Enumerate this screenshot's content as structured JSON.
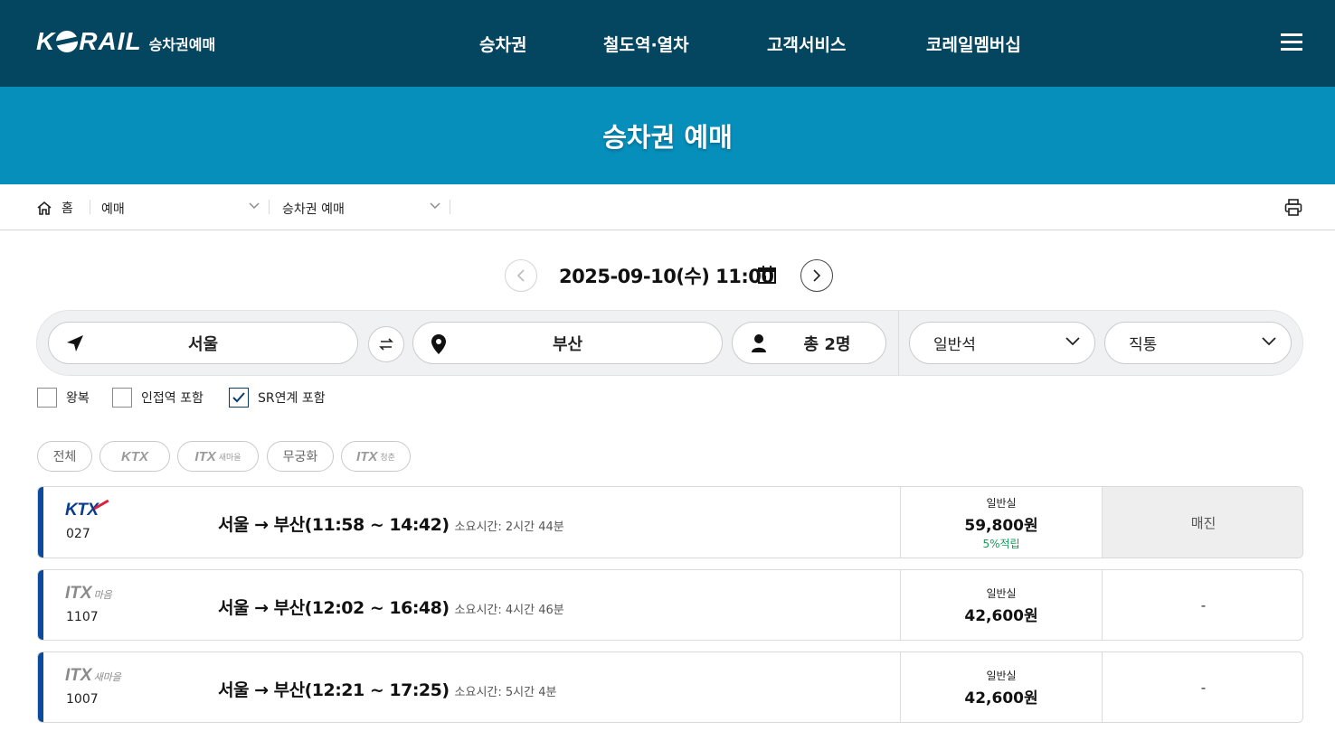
{
  "header": {
    "logo_text": "KRAIL",
    "logo_prefix": "K",
    "logo_suffix": "RAIL",
    "logo_sub": "승차권예매",
    "nav": [
      "승차권",
      "철도역·열차",
      "고객서비스",
      "코레일멤버십"
    ],
    "menu_icon": "hamburger-icon"
  },
  "banner": {
    "title": "승차권 예매"
  },
  "breadcrumb": {
    "home": "홈",
    "level1": "예매",
    "level2": "승차권 예매"
  },
  "date": {
    "text": "2025-09-10(수) 11:00"
  },
  "search": {
    "from": "서울",
    "to": "부산",
    "passengers": "총 2명",
    "seat_class": "일반석",
    "route_type": "직통"
  },
  "options": {
    "round_trip": "왕복",
    "nearby": "인접역 포함",
    "sr": "SR연계 포함",
    "sr_checked": true
  },
  "filters": {
    "all": "전체",
    "ktx": "KTX",
    "itx_saemaeul": "ITX",
    "itx_saemaeul_sub": "새마을",
    "mugunghwa": "무궁화",
    "itx_cheongchun": "ITX",
    "itx_cheongchun_sub": "청춘"
  },
  "trains": [
    {
      "type": "KTX",
      "type_sub": "",
      "number": "027",
      "route": "서울 → 부산(11:58 ~ 14:42)",
      "duration": "소요시간: 2시간 44분",
      "seat_class": "일반실",
      "price": "59,800원",
      "points": "5%적립",
      "status": "매진"
    },
    {
      "type": "ITX",
      "type_sub": "마음",
      "number": "1107",
      "route": "서울 → 부산(12:02 ~ 16:48)",
      "duration": "소요시간: 4시간 46분",
      "seat_class": "일반실",
      "price": "42,600원",
      "points": "",
      "status": "-"
    },
    {
      "type": "ITX",
      "type_sub": "새마을",
      "number": "1007",
      "route": "서울 → 부산(12:21 ~ 17:25)",
      "duration": "소요시간: 5시간 4분",
      "seat_class": "일반실",
      "price": "42,600원",
      "points": "",
      "status": "-"
    }
  ],
  "colors": {
    "header_bg": "#04455f",
    "banner_bg": "#078fbc",
    "row_accent": "#0a4b9c",
    "points_green": "#1a9a5a"
  }
}
